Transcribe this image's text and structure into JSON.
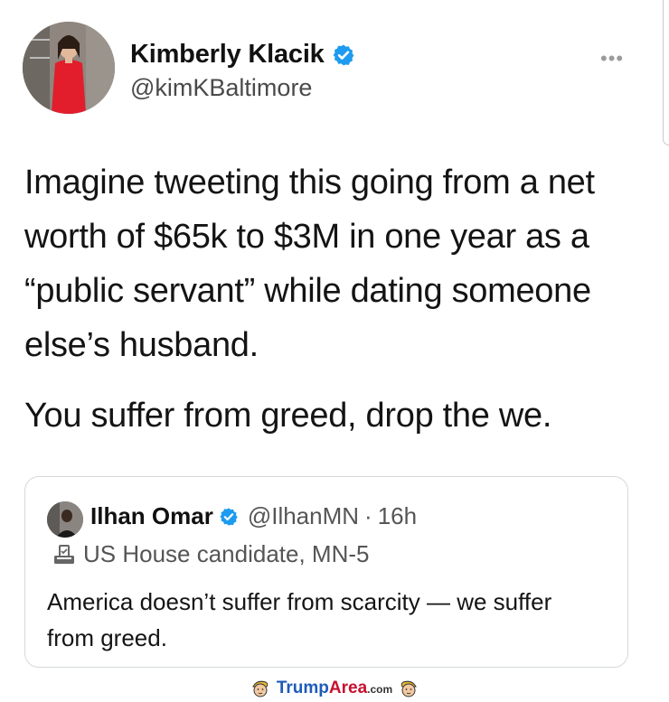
{
  "tweet": {
    "author_name": "Kimberly Klacik",
    "author_handle": "@kimKBaltimore",
    "verified_icon": "verified-badge-icon",
    "more_icon": "more-options-icon",
    "more_label": "•••",
    "paragraphs": [
      "Imagine tweeting this going from a net worth of $65k to $3M in one year as a “public servant” while dating someone else’s husband.",
      "You suffer from greed, drop the we."
    ]
  },
  "quoted_tweet": {
    "author_name": "Ilhan Omar",
    "author_handle": "@IlhanMN",
    "separator": "·",
    "time": "16h",
    "label_icon": "ballot-box-icon",
    "label": "US House candidate, MN-5",
    "text": "America doesn’t suffer from scarcity — we suffer from greed."
  },
  "footer": {
    "brand_main": "Trump",
    "brand_accent": "Area",
    "brand_tld": ".com",
    "logo_icon": "trump-face-icon"
  },
  "colors": {
    "verified": "#1d9bf0",
    "brand_blue": "#1e5bb8",
    "brand_red": "#c8102e",
    "card_border": "#d5d8db"
  }
}
